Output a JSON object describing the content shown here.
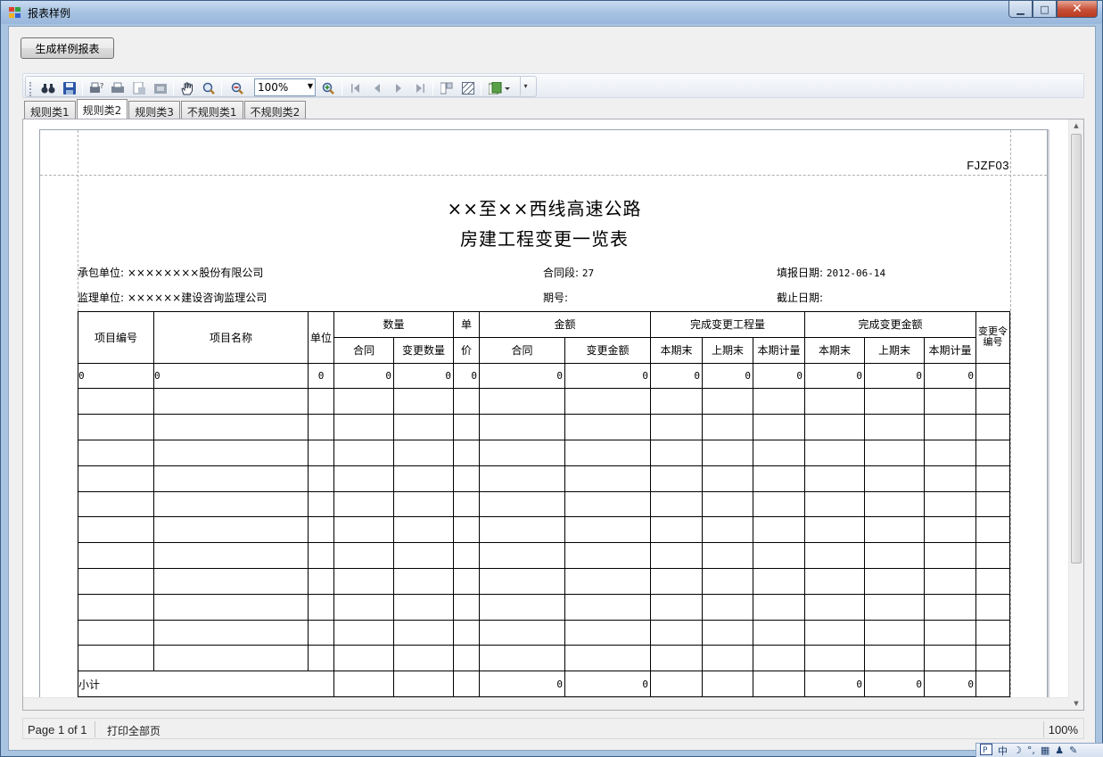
{
  "window": {
    "title": "报表样例",
    "btn_min": "▁",
    "btn_max": "□",
    "btn_close": "✕"
  },
  "actions": {
    "generate_label": "生成样例报表"
  },
  "toolbar": {
    "zoom_value": "100%",
    "icons": [
      "find-icon",
      "save-icon",
      "print-setup-icon",
      "print-icon",
      "page-setup-icon",
      "export-icon",
      "hand-icon",
      "magnifier-icon",
      "zoom-out-icon",
      "zoom-in-icon",
      "first-page-icon",
      "prev-page-icon",
      "next-page-icon",
      "last-page-icon",
      "multipage-icon",
      "watermark-icon",
      "export-document-icon"
    ]
  },
  "tabs": [
    {
      "label": "规则类1",
      "active": false
    },
    {
      "label": "规则类2",
      "active": true
    },
    {
      "label": "规则类3",
      "active": false
    },
    {
      "label": "不规则类1",
      "active": false
    },
    {
      "label": "不规则类2",
      "active": false
    }
  ],
  "report": {
    "code": "FJZF03",
    "title1": "××至××西线高速公路",
    "title2": "房建工程变更一览表",
    "contractor_label": "承包单位:",
    "contractor_value": "××××××××股份有限公司",
    "section_label": "合同段:",
    "section_value": "27",
    "report_date_label": "填报日期:",
    "report_date_value": "2012-06-14",
    "supervisor_label": "监理单位:",
    "supervisor_value": "××××××建设咨询监理公司",
    "period_label": "期号:",
    "period_value": "",
    "deadline_label": "截止日期:",
    "deadline_value": "",
    "headers": {
      "item_no": "项目编号",
      "item_name": "项目名称",
      "unit": "单位",
      "quantity": "数量",
      "qty_contract": "合同",
      "qty_change": "变更数量",
      "unit_price_top": "单",
      "unit_price_bottom": "价",
      "amount": "金额",
      "amt_contract": "合同",
      "amt_change": "变更金额",
      "done_qty": "完成变更工程量",
      "done_amt": "完成变更金额",
      "cur_end": "本期末",
      "prev_end": "上期末",
      "cur_measure": "本期计量",
      "change_order_no": "变更令编号"
    },
    "first_row": {
      "item_no": "0",
      "item_name": "0",
      "unit": "0",
      "qty_contract": "0",
      "qty_change": "0",
      "unit_price": "0",
      "amt_contract": "0",
      "amt_change": "0",
      "dq_cur": "0",
      "dq_prev": "0",
      "dq_measure": "0",
      "da_cur": "0",
      "da_prev": "0",
      "da_measure": "0",
      "change_order": ""
    },
    "subtotal": {
      "label": "小计",
      "amt_contract": "0",
      "amt_change": "0",
      "da_cur": "0",
      "da_prev": "0",
      "da_measure": "0"
    }
  },
  "status": {
    "page": "Page 1 of 1",
    "print_all": "打印全部页",
    "zoom": "100%"
  },
  "ime": {
    "mode": "中"
  }
}
